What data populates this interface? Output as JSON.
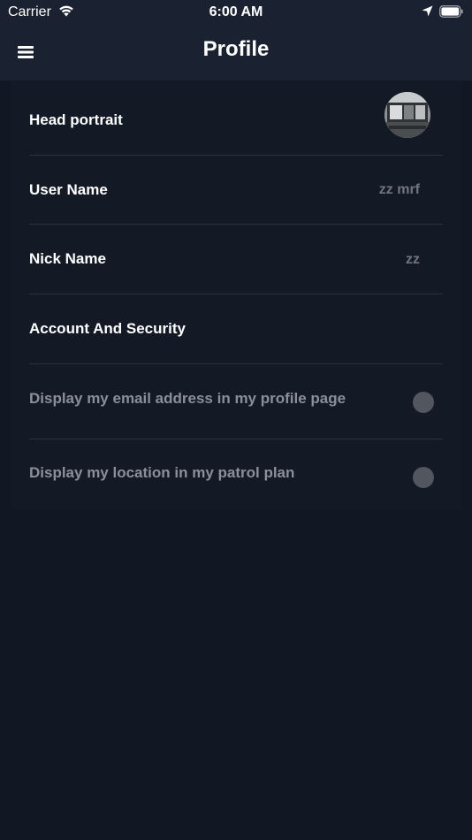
{
  "status_bar": {
    "carrier": "Carrier",
    "time": "6:00 AM"
  },
  "nav": {
    "title": "Profile",
    "menu_icon": "hamburger-menu-icon"
  },
  "profile": {
    "head_portrait_label": "Head portrait",
    "user_name_label": "User Name",
    "user_name_value": "zz mrf",
    "nick_name_label": "Nick Name",
    "nick_name_value": "zz",
    "account_security_label": "Account And Security",
    "email_toggle_label": "Display my email address in my profile page",
    "email_toggle_on": false,
    "location_toggle_label": "Display my location in my patrol plan",
    "location_toggle_on": false
  },
  "colors": {
    "background": "#111723",
    "header": "#1a2130",
    "panel": "#131a26",
    "dim_text": "#8a8f99",
    "value_text": "#70757f",
    "toggle_off": "#52565e"
  }
}
